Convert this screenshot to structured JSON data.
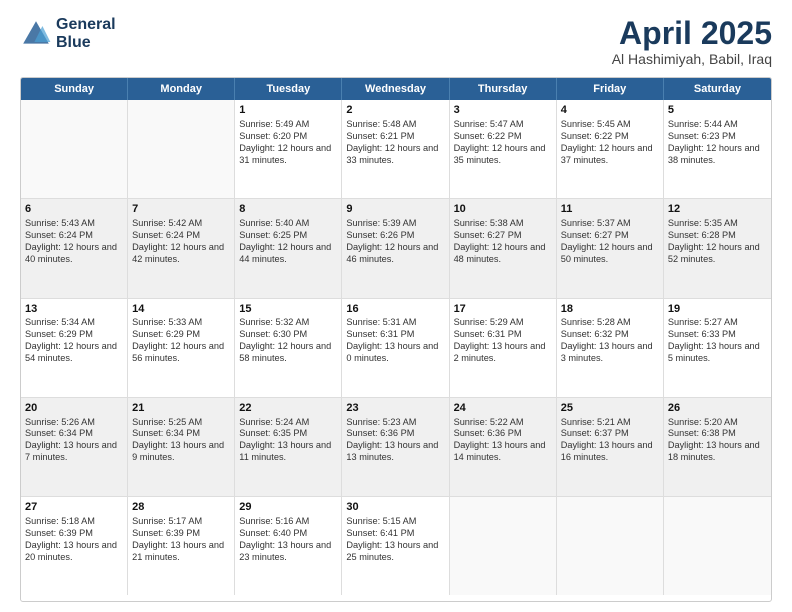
{
  "logo": {
    "line1": "General",
    "line2": "Blue"
  },
  "title": "April 2025",
  "location": "Al Hashimiyah, Babil, Iraq",
  "days_of_week": [
    "Sunday",
    "Monday",
    "Tuesday",
    "Wednesday",
    "Thursday",
    "Friday",
    "Saturday"
  ],
  "weeks": [
    [
      {
        "day": "",
        "sunrise": "",
        "sunset": "",
        "daylight": "",
        "empty": true
      },
      {
        "day": "",
        "sunrise": "",
        "sunset": "",
        "daylight": "",
        "empty": true
      },
      {
        "day": "1",
        "sunrise": "Sunrise: 5:49 AM",
        "sunset": "Sunset: 6:20 PM",
        "daylight": "Daylight: 12 hours and 31 minutes."
      },
      {
        "day": "2",
        "sunrise": "Sunrise: 5:48 AM",
        "sunset": "Sunset: 6:21 PM",
        "daylight": "Daylight: 12 hours and 33 minutes."
      },
      {
        "day": "3",
        "sunrise": "Sunrise: 5:47 AM",
        "sunset": "Sunset: 6:22 PM",
        "daylight": "Daylight: 12 hours and 35 minutes."
      },
      {
        "day": "4",
        "sunrise": "Sunrise: 5:45 AM",
        "sunset": "Sunset: 6:22 PM",
        "daylight": "Daylight: 12 hours and 37 minutes."
      },
      {
        "day": "5",
        "sunrise": "Sunrise: 5:44 AM",
        "sunset": "Sunset: 6:23 PM",
        "daylight": "Daylight: 12 hours and 38 minutes."
      }
    ],
    [
      {
        "day": "6",
        "sunrise": "Sunrise: 5:43 AM",
        "sunset": "Sunset: 6:24 PM",
        "daylight": "Daylight: 12 hours and 40 minutes."
      },
      {
        "day": "7",
        "sunrise": "Sunrise: 5:42 AM",
        "sunset": "Sunset: 6:24 PM",
        "daylight": "Daylight: 12 hours and 42 minutes."
      },
      {
        "day": "8",
        "sunrise": "Sunrise: 5:40 AM",
        "sunset": "Sunset: 6:25 PM",
        "daylight": "Daylight: 12 hours and 44 minutes."
      },
      {
        "day": "9",
        "sunrise": "Sunrise: 5:39 AM",
        "sunset": "Sunset: 6:26 PM",
        "daylight": "Daylight: 12 hours and 46 minutes."
      },
      {
        "day": "10",
        "sunrise": "Sunrise: 5:38 AM",
        "sunset": "Sunset: 6:27 PM",
        "daylight": "Daylight: 12 hours and 48 minutes."
      },
      {
        "day": "11",
        "sunrise": "Sunrise: 5:37 AM",
        "sunset": "Sunset: 6:27 PM",
        "daylight": "Daylight: 12 hours and 50 minutes."
      },
      {
        "day": "12",
        "sunrise": "Sunrise: 5:35 AM",
        "sunset": "Sunset: 6:28 PM",
        "daylight": "Daylight: 12 hours and 52 minutes."
      }
    ],
    [
      {
        "day": "13",
        "sunrise": "Sunrise: 5:34 AM",
        "sunset": "Sunset: 6:29 PM",
        "daylight": "Daylight: 12 hours and 54 minutes."
      },
      {
        "day": "14",
        "sunrise": "Sunrise: 5:33 AM",
        "sunset": "Sunset: 6:29 PM",
        "daylight": "Daylight: 12 hours and 56 minutes."
      },
      {
        "day": "15",
        "sunrise": "Sunrise: 5:32 AM",
        "sunset": "Sunset: 6:30 PM",
        "daylight": "Daylight: 12 hours and 58 minutes."
      },
      {
        "day": "16",
        "sunrise": "Sunrise: 5:31 AM",
        "sunset": "Sunset: 6:31 PM",
        "daylight": "Daylight: 13 hours and 0 minutes."
      },
      {
        "day": "17",
        "sunrise": "Sunrise: 5:29 AM",
        "sunset": "Sunset: 6:31 PM",
        "daylight": "Daylight: 13 hours and 2 minutes."
      },
      {
        "day": "18",
        "sunrise": "Sunrise: 5:28 AM",
        "sunset": "Sunset: 6:32 PM",
        "daylight": "Daylight: 13 hours and 3 minutes."
      },
      {
        "day": "19",
        "sunrise": "Sunrise: 5:27 AM",
        "sunset": "Sunset: 6:33 PM",
        "daylight": "Daylight: 13 hours and 5 minutes."
      }
    ],
    [
      {
        "day": "20",
        "sunrise": "Sunrise: 5:26 AM",
        "sunset": "Sunset: 6:34 PM",
        "daylight": "Daylight: 13 hours and 7 minutes."
      },
      {
        "day": "21",
        "sunrise": "Sunrise: 5:25 AM",
        "sunset": "Sunset: 6:34 PM",
        "daylight": "Daylight: 13 hours and 9 minutes."
      },
      {
        "day": "22",
        "sunrise": "Sunrise: 5:24 AM",
        "sunset": "Sunset: 6:35 PM",
        "daylight": "Daylight: 13 hours and 11 minutes."
      },
      {
        "day": "23",
        "sunrise": "Sunrise: 5:23 AM",
        "sunset": "Sunset: 6:36 PM",
        "daylight": "Daylight: 13 hours and 13 minutes."
      },
      {
        "day": "24",
        "sunrise": "Sunrise: 5:22 AM",
        "sunset": "Sunset: 6:36 PM",
        "daylight": "Daylight: 13 hours and 14 minutes."
      },
      {
        "day": "25",
        "sunrise": "Sunrise: 5:21 AM",
        "sunset": "Sunset: 6:37 PM",
        "daylight": "Daylight: 13 hours and 16 minutes."
      },
      {
        "day": "26",
        "sunrise": "Sunrise: 5:20 AM",
        "sunset": "Sunset: 6:38 PM",
        "daylight": "Daylight: 13 hours and 18 minutes."
      }
    ],
    [
      {
        "day": "27",
        "sunrise": "Sunrise: 5:18 AM",
        "sunset": "Sunset: 6:39 PM",
        "daylight": "Daylight: 13 hours and 20 minutes."
      },
      {
        "day": "28",
        "sunrise": "Sunrise: 5:17 AM",
        "sunset": "Sunset: 6:39 PM",
        "daylight": "Daylight: 13 hours and 21 minutes."
      },
      {
        "day": "29",
        "sunrise": "Sunrise: 5:16 AM",
        "sunset": "Sunset: 6:40 PM",
        "daylight": "Daylight: 13 hours and 23 minutes."
      },
      {
        "day": "30",
        "sunrise": "Sunrise: 5:15 AM",
        "sunset": "Sunset: 6:41 PM",
        "daylight": "Daylight: 13 hours and 25 minutes."
      },
      {
        "day": "",
        "sunrise": "",
        "sunset": "",
        "daylight": "",
        "empty": true
      },
      {
        "day": "",
        "sunrise": "",
        "sunset": "",
        "daylight": "",
        "empty": true
      },
      {
        "day": "",
        "sunrise": "",
        "sunset": "",
        "daylight": "",
        "empty": true
      }
    ]
  ]
}
